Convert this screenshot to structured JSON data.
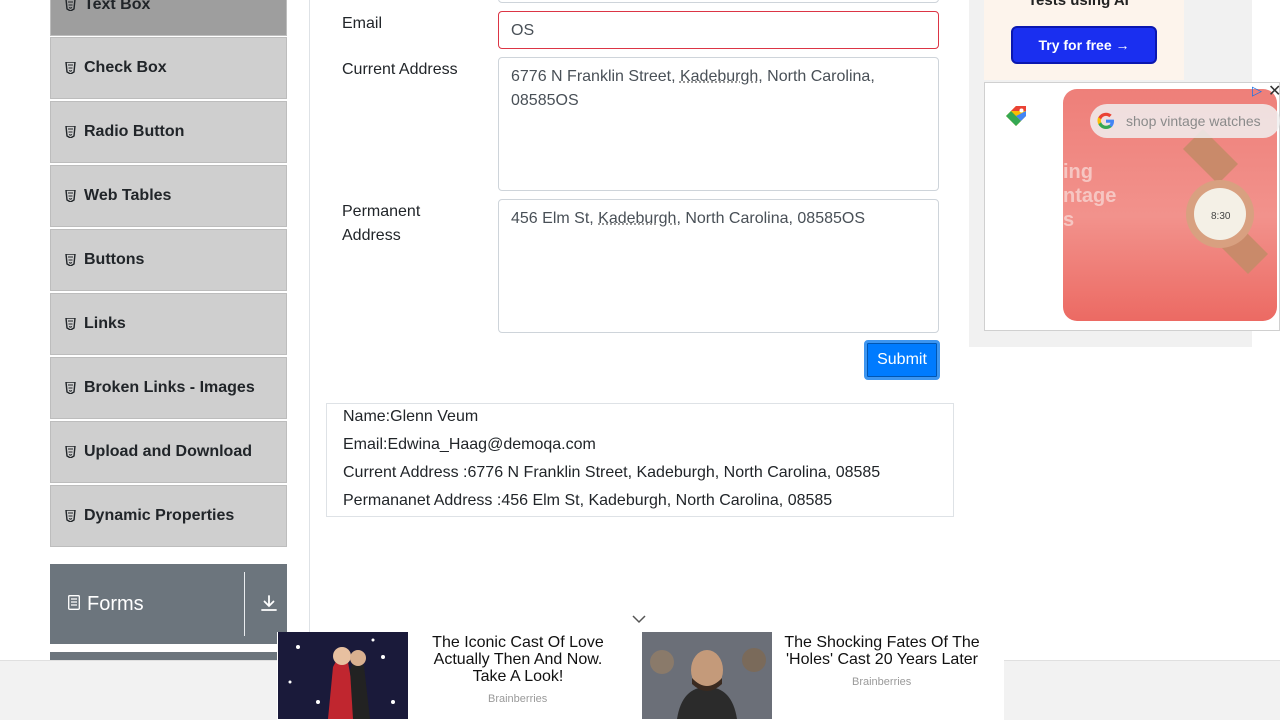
{
  "sidebar": {
    "items": [
      {
        "label": "Text Box"
      },
      {
        "label": "Check Box"
      },
      {
        "label": "Radio Button"
      },
      {
        "label": "Web Tables"
      },
      {
        "label": "Buttons"
      },
      {
        "label": "Links"
      },
      {
        "label": "Broken Links - Images"
      },
      {
        "label": "Upload and Download"
      },
      {
        "label": "Dynamic Properties"
      }
    ],
    "group_label": "Forms"
  },
  "form": {
    "email_label": "Email",
    "email_value": "OS",
    "current_address_label": "Current Address",
    "current_address_parts": [
      "6776 N Franklin Street, ",
      "Kadeburgh",
      ", North Carolina,",
      "08585OS"
    ],
    "permanent_address_label_1": "Permanent",
    "permanent_address_label_2": "Address",
    "permanent_address_parts": [
      "456 Elm St, ",
      "Kadeburgh",
      ", North Carolina, 08585OS"
    ],
    "submit_label": "Submit"
  },
  "output": {
    "name": "Name:Glenn Veum",
    "email": "Email:Edwina_Haag@demoqa.com",
    "current_address": "Current Address :6776 N Franklin Street, Kadeburgh, North Carolina, 08585",
    "permanent_address": "Permananet Address :456 Elm St, Kadeburgh, North Carolina, 08585"
  },
  "ad_right": {
    "top_text": "Tests using AI",
    "try_button": "Try for free →",
    "search_text": "shop vintage watches",
    "faded_text_1": "ing",
    "faded_text_2": "ntage",
    "faded_text_3": "s"
  },
  "bottom_ads": [
    {
      "title_1": "The Iconic Cast Of Love",
      "title_2": "Actually Then And Now.",
      "title_3": "Take A Look!",
      "source": "Brainberries"
    },
    {
      "title_1": "The Shocking Fates Of The",
      "title_2": "'Holes' Cast 20 Years Later",
      "source": "Brainberries"
    }
  ],
  "colors": {
    "primary": "#007bff",
    "error_border": "#dc3545",
    "nav_item": "#cfcfcf",
    "group_header": "#6c757d"
  }
}
